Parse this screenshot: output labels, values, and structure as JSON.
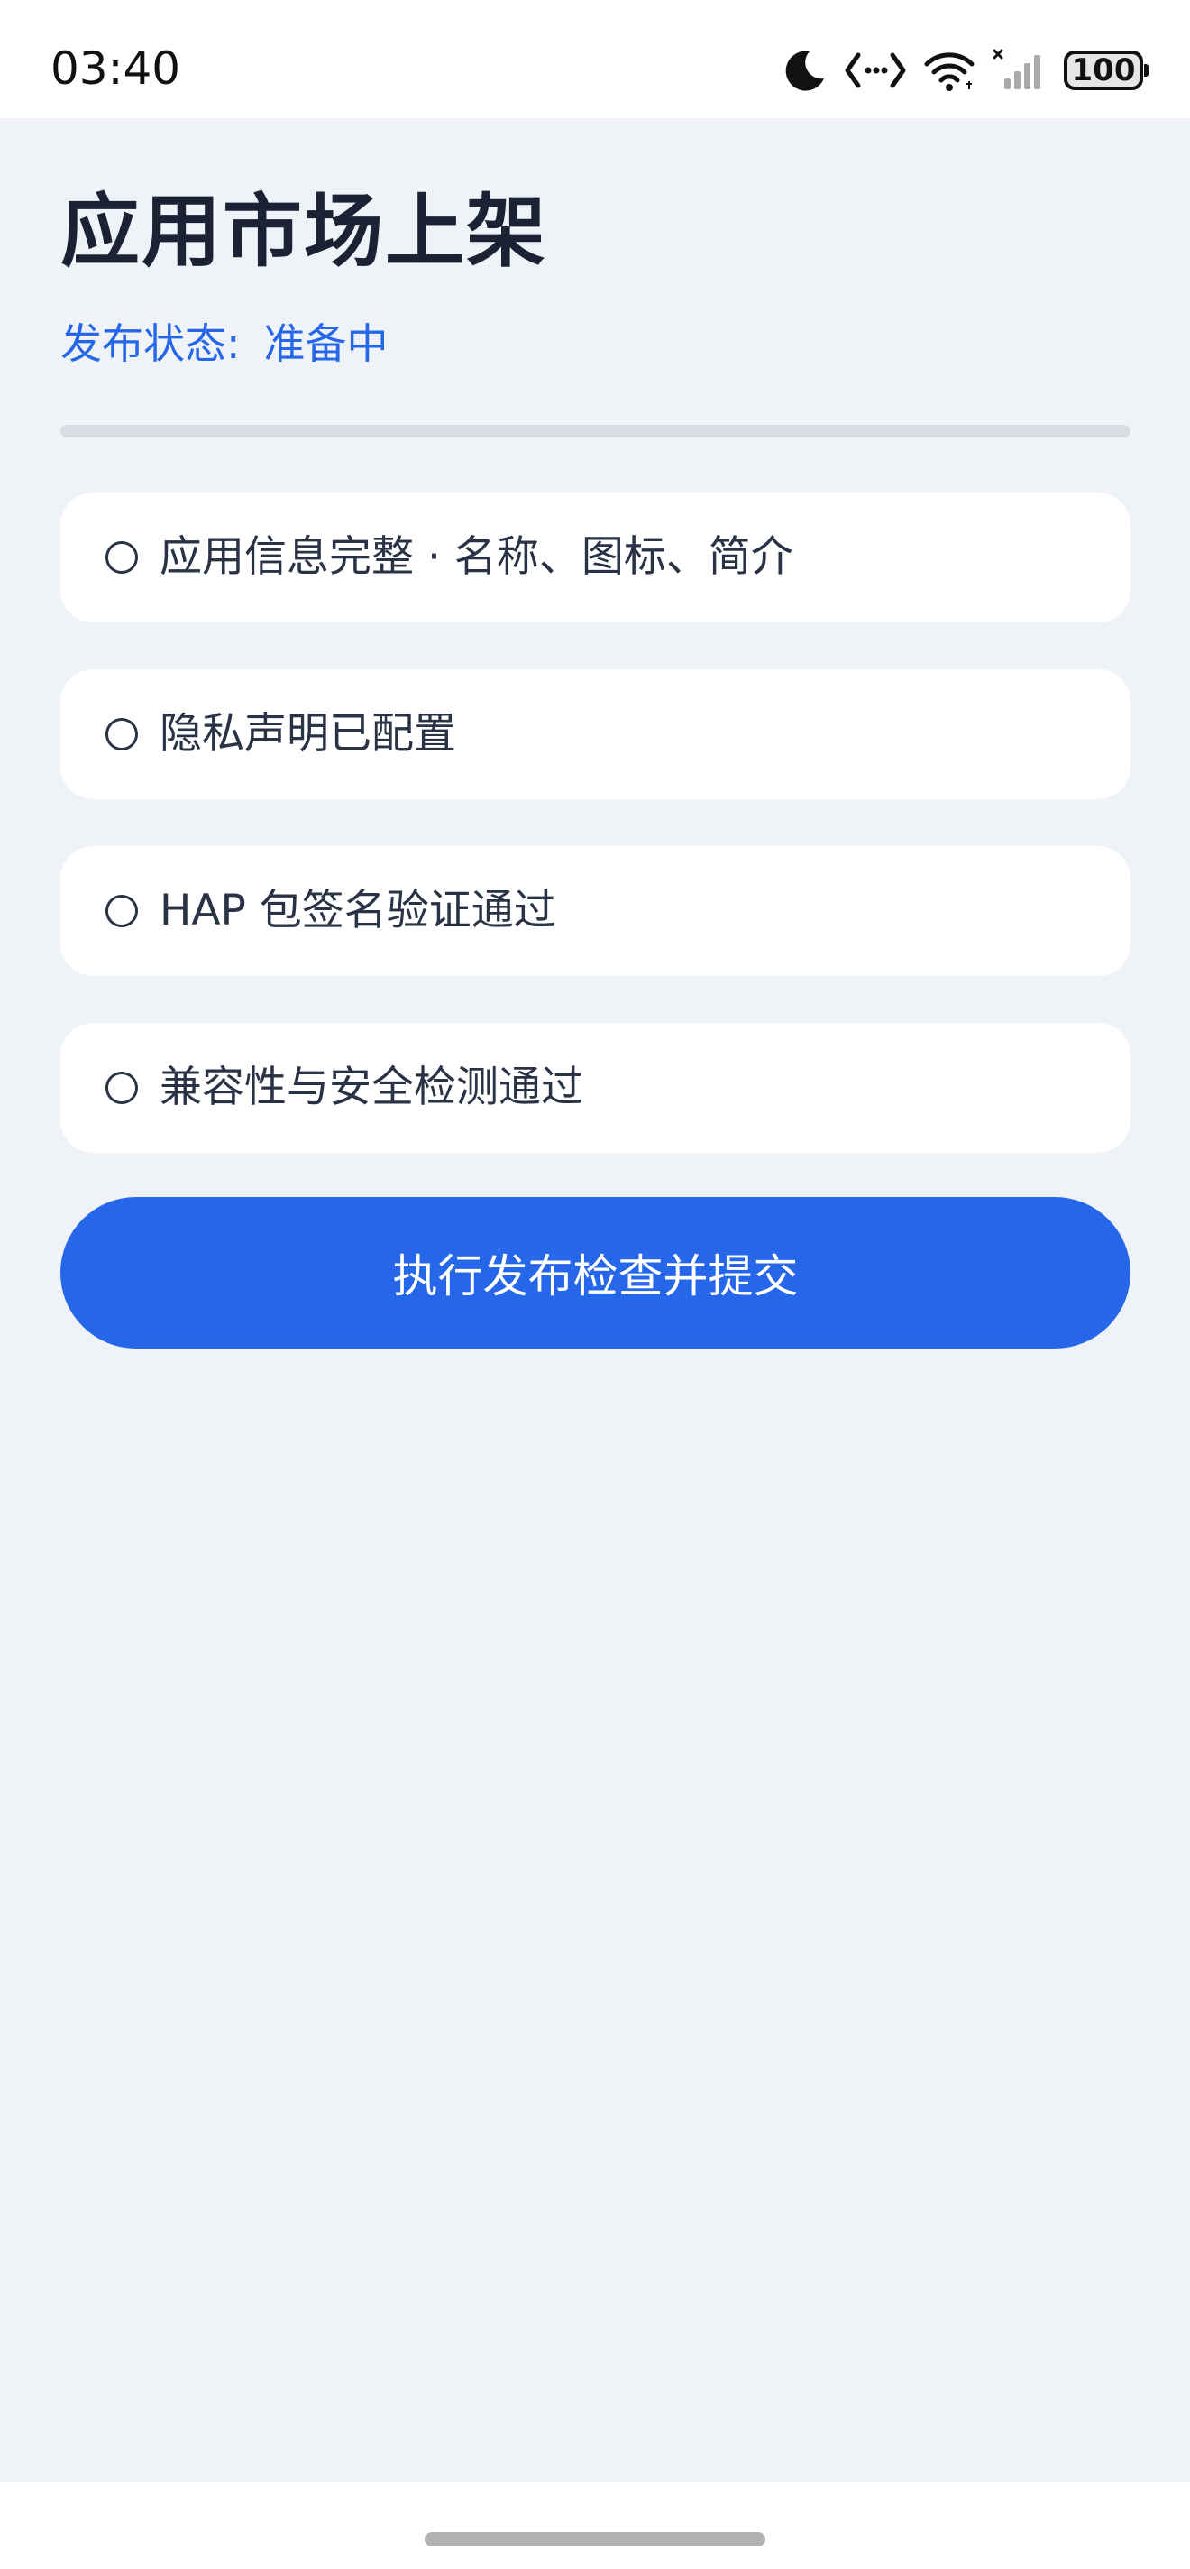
{
  "status_bar": {
    "time": "03:40",
    "icons": [
      "moon-icon",
      "code-icon",
      "wifi-icon",
      "signal-icon"
    ],
    "battery": "100"
  },
  "header": {
    "title": "应用市场上架",
    "status_label": "发布状态:",
    "status_value": "准备中"
  },
  "progress": {
    "value": 0
  },
  "checklist": [
    {
      "label": "应用信息完整 · 名称、图标、简介",
      "checked": false
    },
    {
      "label": "隐私声明已配置",
      "checked": false
    },
    {
      "label": "HAP 包签名验证通过",
      "checked": false
    },
    {
      "label": "兼容性与安全检测通过",
      "checked": false
    }
  ],
  "submit_button": {
    "label": "执行发布检查并提交"
  },
  "colors": {
    "accent": "#2567e8",
    "background": "#eff3f8",
    "card": "#ffffff",
    "title": "#1a2233",
    "text": "#2a3345"
  }
}
